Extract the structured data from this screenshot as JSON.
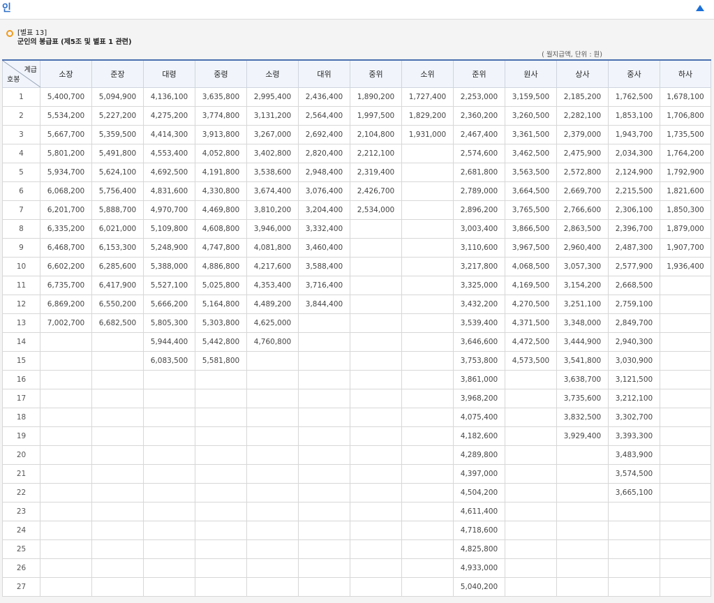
{
  "header": {
    "title": "인"
  },
  "caption": {
    "label": "[별표 13]",
    "subtitle": "군인의 봉급표 (제5조 및 별표 1 관련)"
  },
  "unit_note": "( 월지급액, 단위 : 원)",
  "table": {
    "corner_top": "계급",
    "corner_bottom": "호봉",
    "columns": [
      "소장",
      "준장",
      "대령",
      "중령",
      "소령",
      "대위",
      "중위",
      "소위",
      "준위",
      "원사",
      "상사",
      "중사",
      "하사"
    ],
    "rows": [
      [
        "1",
        "5,400,700",
        "5,094,900",
        "4,136,100",
        "3,635,800",
        "2,995,400",
        "2,436,400",
        "1,890,200",
        "1,727,400",
        "2,253,000",
        "3,159,500",
        "2,185,200",
        "1,762,500",
        "1,678,100"
      ],
      [
        "2",
        "5,534,200",
        "5,227,200",
        "4,275,200",
        "3,774,800",
        "3,131,200",
        "2,564,400",
        "1,997,500",
        "1,829,200",
        "2,360,200",
        "3,260,500",
        "2,282,100",
        "1,853,100",
        "1,706,800"
      ],
      [
        "3",
        "5,667,700",
        "5,359,500",
        "4,414,300",
        "3,913,800",
        "3,267,000",
        "2,692,400",
        "2,104,800",
        "1,931,000",
        "2,467,400",
        "3,361,500",
        "2,379,000",
        "1,943,700",
        "1,735,500"
      ],
      [
        "4",
        "5,801,200",
        "5,491,800",
        "4,553,400",
        "4,052,800",
        "3,402,800",
        "2,820,400",
        "2,212,100",
        "",
        "2,574,600",
        "3,462,500",
        "2,475,900",
        "2,034,300",
        "1,764,200"
      ],
      [
        "5",
        "5,934,700",
        "5,624,100",
        "4,692,500",
        "4,191,800",
        "3,538,600",
        "2,948,400",
        "2,319,400",
        "",
        "2,681,800",
        "3,563,500",
        "2,572,800",
        "2,124,900",
        "1,792,900"
      ],
      [
        "6",
        "6,068,200",
        "5,756,400",
        "4,831,600",
        "4,330,800",
        "3,674,400",
        "3,076,400",
        "2,426,700",
        "",
        "2,789,000",
        "3,664,500",
        "2,669,700",
        "2,215,500",
        "1,821,600"
      ],
      [
        "7",
        "6,201,700",
        "5,888,700",
        "4,970,700",
        "4,469,800",
        "3,810,200",
        "3,204,400",
        "2,534,000",
        "",
        "2,896,200",
        "3,765,500",
        "2,766,600",
        "2,306,100",
        "1,850,300"
      ],
      [
        "8",
        "6,335,200",
        "6,021,000",
        "5,109,800",
        "4,608,800",
        "3,946,000",
        "3,332,400",
        "",
        "",
        "3,003,400",
        "3,866,500",
        "2,863,500",
        "2,396,700",
        "1,879,000"
      ],
      [
        "9",
        "6,468,700",
        "6,153,300",
        "5,248,900",
        "4,747,800",
        "4,081,800",
        "3,460,400",
        "",
        "",
        "3,110,600",
        "3,967,500",
        "2,960,400",
        "2,487,300",
        "1,907,700"
      ],
      [
        "10",
        "6,602,200",
        "6,285,600",
        "5,388,000",
        "4,886,800",
        "4,217,600",
        "3,588,400",
        "",
        "",
        "3,217,800",
        "4,068,500",
        "3,057,300",
        "2,577,900",
        "1,936,400"
      ],
      [
        "11",
        "6,735,700",
        "6,417,900",
        "5,527,100",
        "5,025,800",
        "4,353,400",
        "3,716,400",
        "",
        "",
        "3,325,000",
        "4,169,500",
        "3,154,200",
        "2,668,500",
        ""
      ],
      [
        "12",
        "6,869,200",
        "6,550,200",
        "5,666,200",
        "5,164,800",
        "4,489,200",
        "3,844,400",
        "",
        "",
        "3,432,200",
        "4,270,500",
        "3,251,100",
        "2,759,100",
        ""
      ],
      [
        "13",
        "7,002,700",
        "6,682,500",
        "5,805,300",
        "5,303,800",
        "4,625,000",
        "",
        "",
        "",
        "3,539,400",
        "4,371,500",
        "3,348,000",
        "2,849,700",
        ""
      ],
      [
        "14",
        "",
        "",
        "5,944,400",
        "5,442,800",
        "4,760,800",
        "",
        "",
        "",
        "3,646,600",
        "4,472,500",
        "3,444,900",
        "2,940,300",
        ""
      ],
      [
        "15",
        "",
        "",
        "6,083,500",
        "5,581,800",
        "",
        "",
        "",
        "",
        "3,753,800",
        "4,573,500",
        "3,541,800",
        "3,030,900",
        ""
      ],
      [
        "16",
        "",
        "",
        "",
        "",
        "",
        "",
        "",
        "",
        "3,861,000",
        "",
        "3,638,700",
        "3,121,500",
        ""
      ],
      [
        "17",
        "",
        "",
        "",
        "",
        "",
        "",
        "",
        "",
        "3,968,200",
        "",
        "3,735,600",
        "3,212,100",
        ""
      ],
      [
        "18",
        "",
        "",
        "",
        "",
        "",
        "",
        "",
        "",
        "4,075,400",
        "",
        "3,832,500",
        "3,302,700",
        ""
      ],
      [
        "19",
        "",
        "",
        "",
        "",
        "",
        "",
        "",
        "",
        "4,182,600",
        "",
        "3,929,400",
        "3,393,300",
        ""
      ],
      [
        "20",
        "",
        "",
        "",
        "",
        "",
        "",
        "",
        "",
        "4,289,800",
        "",
        "",
        "3,483,900",
        ""
      ],
      [
        "21",
        "",
        "",
        "",
        "",
        "",
        "",
        "",
        "",
        "4,397,000",
        "",
        "",
        "3,574,500",
        ""
      ],
      [
        "22",
        "",
        "",
        "",
        "",
        "",
        "",
        "",
        "",
        "4,504,200",
        "",
        "",
        "3,665,100",
        ""
      ],
      [
        "23",
        "",
        "",
        "",
        "",
        "",
        "",
        "",
        "",
        "4,611,400",
        "",
        "",
        "",
        ""
      ],
      [
        "24",
        "",
        "",
        "",
        "",
        "",
        "",
        "",
        "",
        "4,718,600",
        "",
        "",
        "",
        ""
      ],
      [
        "25",
        "",
        "",
        "",
        "",
        "",
        "",
        "",
        "",
        "4,825,800",
        "",
        "",
        "",
        ""
      ],
      [
        "26",
        "",
        "",
        "",
        "",
        "",
        "",
        "",
        "",
        "4,933,000",
        "",
        "",
        "",
        ""
      ],
      [
        "27",
        "",
        "",
        "",
        "",
        "",
        "",
        "",
        "",
        "5,040,200",
        "",
        "",
        "",
        ""
      ]
    ]
  }
}
